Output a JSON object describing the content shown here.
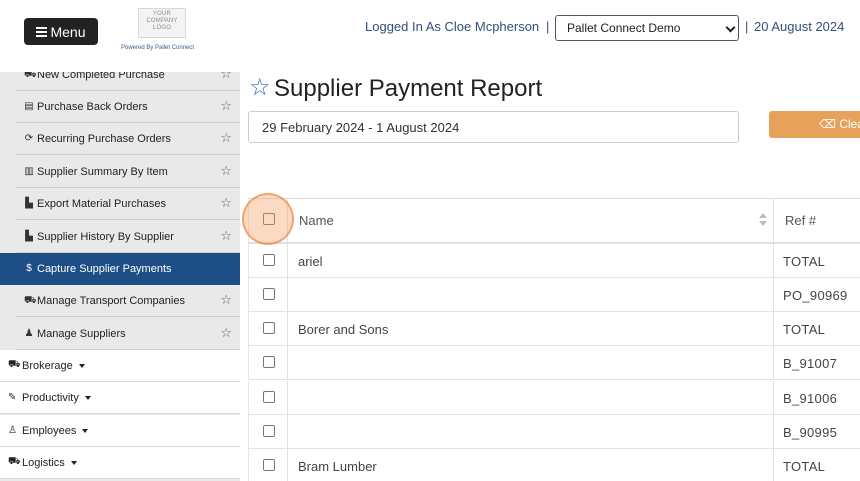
{
  "header": {
    "menu_label": "Menu",
    "logo_text_1": "YOUR",
    "logo_text_2": "COMPANY",
    "logo_text_3": "LOGO",
    "powered_by": "Powered By Pallet Connect",
    "logged_in": "Logged In As Cloe Mcpherson",
    "separator": "|",
    "company_selected": "Pallet Connect Demo",
    "date": "20 August 2024"
  },
  "sidebar": {
    "sub_items": [
      {
        "label": "New Completed Purchase",
        "icon": "truck-icon"
      },
      {
        "label": "Purchase Back Orders",
        "icon": "clipboard-icon"
      },
      {
        "label": "Recurring Purchase Orders",
        "icon": "repeat-icon"
      },
      {
        "label": "Supplier Summary By Item",
        "icon": "barcode-icon"
      },
      {
        "label": "Export Material Purchases",
        "icon": "building-icon"
      },
      {
        "label": "Supplier History By Supplier",
        "icon": "chart-icon"
      },
      {
        "label": "Capture Supplier Payments",
        "icon": "dollar-icon"
      },
      {
        "label": "Manage Transport Companies",
        "icon": "truck-icon"
      },
      {
        "label": "Manage Suppliers",
        "icon": "users-icon"
      }
    ],
    "main_items": [
      {
        "label": "Brokerage",
        "icon": "truck-icon"
      },
      {
        "label": "Productivity",
        "icon": "wrench-icon"
      },
      {
        "label": "Employees",
        "icon": "person-icon"
      },
      {
        "label": "Logistics",
        "icon": "truck-icon"
      }
    ],
    "active_item": "Capture Supplier Payments"
  },
  "main": {
    "title": "Supplier Payment Report",
    "date_range": "29 February 2024 - 1 August 2024",
    "clear_label": "Clea"
  },
  "table": {
    "headers": {
      "name": "Name",
      "ref": "Ref #"
    },
    "rows": [
      {
        "name": "ariel",
        "ref": "TOTAL"
      },
      {
        "name": "",
        "ref": "PO_90969"
      },
      {
        "name": "Borer and Sons",
        "ref": "TOTAL"
      },
      {
        "name": "",
        "ref": "B_91007"
      },
      {
        "name": "",
        "ref": "B_91006"
      },
      {
        "name": "",
        "ref": "B_90995"
      },
      {
        "name": "Bram Lumber",
        "ref": "TOTAL"
      }
    ]
  },
  "colors": {
    "active_nav": "#1d4f86",
    "clear_button": "#e6a15a",
    "header_text": "#2f4f7a",
    "highlight": "#f09650"
  }
}
